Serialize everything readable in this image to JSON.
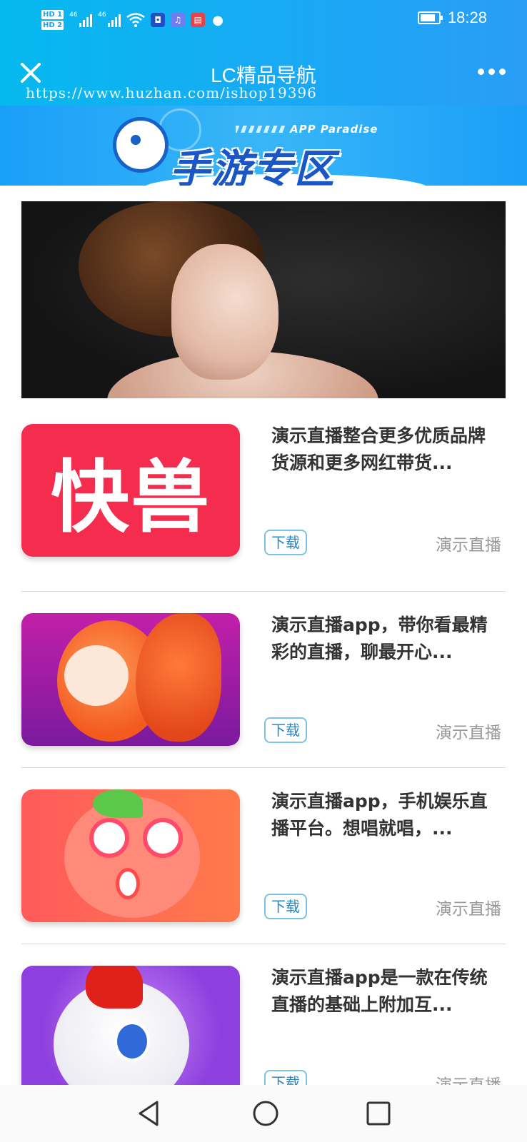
{
  "status_bar": {
    "hd1": "HD 1",
    "hd2": "HD 2",
    "sim1": "46",
    "sim2": "46",
    "time": "18:28",
    "icons": [
      "wifi-icon",
      "shield-app-icon",
      "music-app-icon",
      "book-app-icon",
      "wechat-icon",
      "battery-charging-icon"
    ]
  },
  "nav": {
    "title": "LC精品导航",
    "close_icon": "close-icon",
    "more_icon": "more-dots-icon"
  },
  "watermark": "https://www.huzhan.com/ishop19396",
  "banner": {
    "subtitle": "APP Paradise",
    "title": "手游专区"
  },
  "items": [
    {
      "thumb_text": "快兽",
      "title": "演示直播整合更多优质品牌货源和更多网红带货...",
      "button": "下载",
      "category": "演示直播"
    },
    {
      "title": "演示直播app，带你看最精彩的直播，聊最开心...",
      "button": "下载",
      "category": "演示直播"
    },
    {
      "title": "演示直播app，手机娱乐直播平台。想唱就唱，...",
      "button": "下载",
      "category": "演示直播"
    },
    {
      "title": "演示直播app是一款在传统直播的基础上附加互...",
      "button": "下载",
      "category": "演示直播"
    }
  ],
  "colors": {
    "header_start": "#05b9ee",
    "header_end": "#2a9df7",
    "title_text": "#333333",
    "category_text": "#999999",
    "button_border": "#7cc3e8",
    "button_text": "#2788c4"
  }
}
